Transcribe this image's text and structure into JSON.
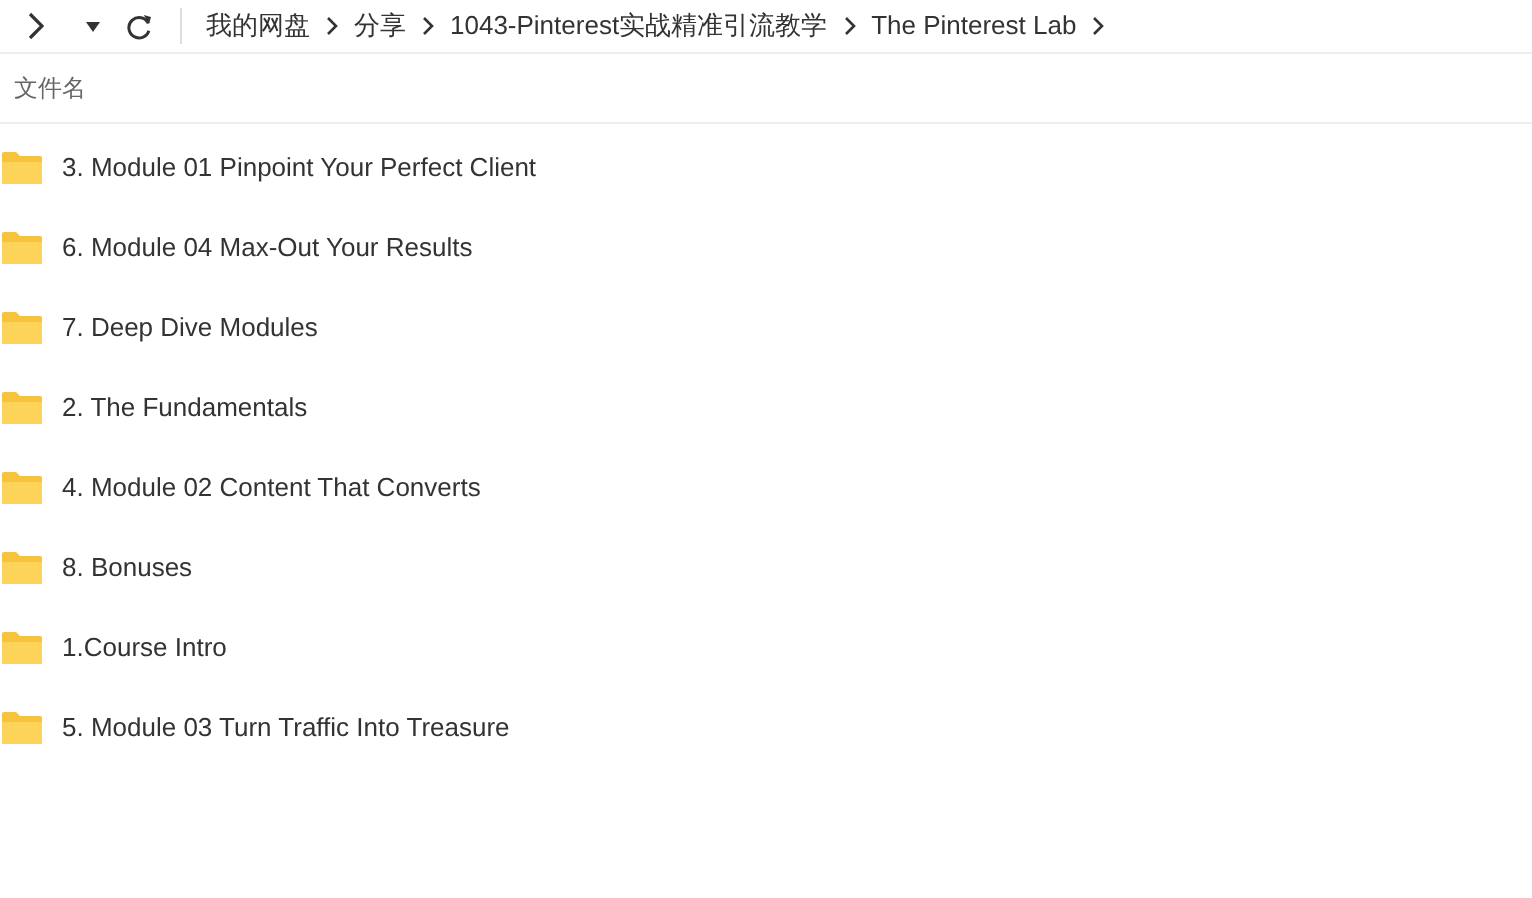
{
  "breadcrumb": [
    "我的网盘",
    "分享",
    "1043-Pinterest实战精准引流教学",
    "The Pinterest Lab"
  ],
  "column_header": "文件名",
  "files": [
    {
      "name": "3. Module 01 Pinpoint Your Perfect Client"
    },
    {
      "name": "6. Module 04 Max-Out Your Results"
    },
    {
      "name": "7. Deep Dive Modules"
    },
    {
      "name": "2. The Fundamentals"
    },
    {
      "name": "4. Module 02 Content That Converts"
    },
    {
      "name": "8. Bonuses"
    },
    {
      "name": "1.Course Intro"
    },
    {
      "name": "5. Module 03 Turn Traffic Into Treasure"
    }
  ]
}
